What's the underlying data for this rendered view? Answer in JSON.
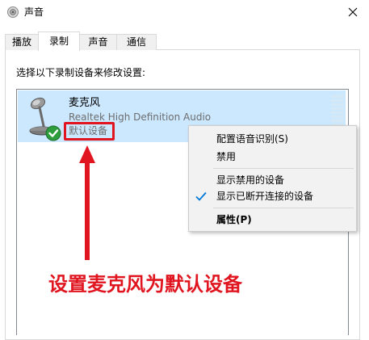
{
  "window": {
    "title": "声音",
    "icon": "speaker-icon",
    "close_icon": "close-icon"
  },
  "tabs": [
    {
      "label": "播放",
      "active": false
    },
    {
      "label": "录制",
      "active": true
    },
    {
      "label": "声音",
      "active": false
    },
    {
      "label": "通信",
      "active": false
    }
  ],
  "instruction": "选择以下录制设备来修改设置:",
  "device": {
    "name": "麦克风",
    "driver": "Realtek High Definition Audio",
    "status": "默认设备",
    "icon": "microphone-icon",
    "status_icon": "green-checkmark-icon"
  },
  "context_menu": {
    "items": [
      {
        "label": "配置语音识别(S)",
        "checked": false,
        "bold": false
      },
      {
        "label": "禁用",
        "checked": false,
        "bold": false
      },
      {
        "label": "显示禁用的设备",
        "checked": false,
        "bold": false
      },
      {
        "label": "显示已断开连接的设备",
        "checked": true,
        "bold": false
      },
      {
        "label": "属性(P)",
        "checked": false,
        "bold": true
      }
    ]
  },
  "annotation": {
    "text": "设置麦克风为默认设备",
    "color": "#e0151f"
  },
  "colors": {
    "selection": "#cce8ff",
    "accent": "#0078d7",
    "annotation_red": "#e0151f"
  }
}
